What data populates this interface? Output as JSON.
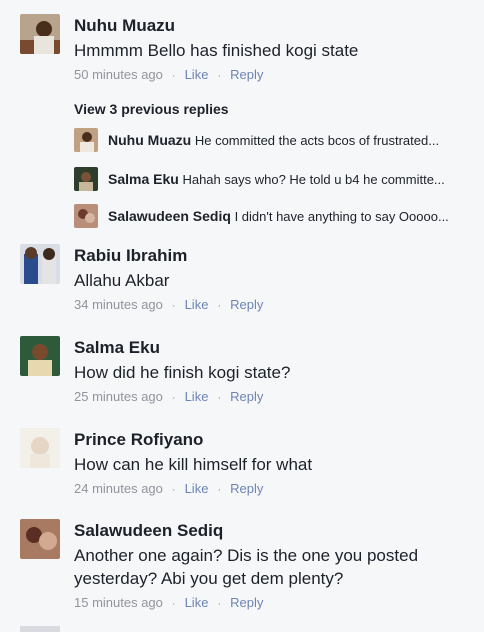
{
  "comments": [
    {
      "name": "Nuhu Muazu",
      "text": "Hmmmm Bello has finished kogi state",
      "time": "50 minutes ago",
      "like": "Like",
      "reply": "Reply"
    },
    {
      "name": "Rabiu Ibrahim",
      "text": "Allahu Akbar",
      "time": "34 minutes ago",
      "like": "Like",
      "reply": "Reply"
    },
    {
      "name": "Salma Eku",
      "text": "How did he finish kogi state?",
      "time": "25 minutes ago",
      "like": "Like",
      "reply": "Reply"
    },
    {
      "name": "Prince Rofiyano",
      "text": "How can he kill himself for what",
      "time": "24 minutes ago",
      "like": "Like",
      "reply": "Reply"
    },
    {
      "name": "Salawudeen Sediq",
      "text_line1": "Another one again? Dis is the one you posted",
      "text_line2": "yesterday? Abi you get dem plenty?",
      "time": "15 minutes ago",
      "like": "Like",
      "reply": "Reply"
    }
  ],
  "view_previous": "View 3 previous replies",
  "replies": [
    {
      "name": "Nuhu Muazu",
      "text": "He committed the acts bcos of frustrated..."
    },
    {
      "name": "Salma Eku",
      "text": "Hahah says who? He told u b4 he committe..."
    },
    {
      "name": "Salawudeen Sediq",
      "text": "I didn't have anything to say Ooooo..."
    }
  ],
  "separator": "·",
  "colors": {
    "background": "#f6f7f9",
    "name": "#1d2129",
    "meta": "#90949c",
    "action": "#6d84b4"
  }
}
